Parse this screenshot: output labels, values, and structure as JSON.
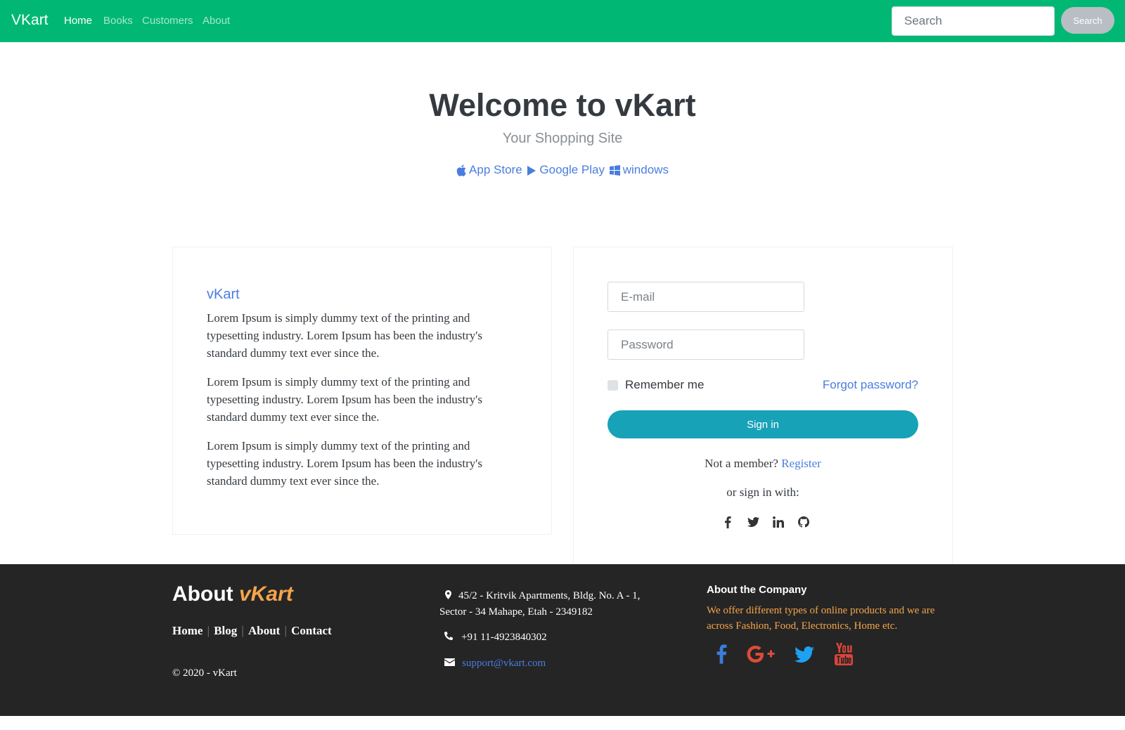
{
  "navbar": {
    "brand": "VKart",
    "links": [
      "Home",
      "Books",
      "Customers",
      "About"
    ],
    "active": "Home",
    "search_placeholder": "Search",
    "search_button": "Search",
    "bg_color": "#00b874"
  },
  "hero": {
    "title": "Welcome to vKart",
    "subtitle": "Your Shopping Site",
    "stores": [
      {
        "label": "App Store",
        "icon": "apple-icon"
      },
      {
        "label": "Google Play",
        "icon": "play-icon"
      },
      {
        "label": "windows",
        "icon": "windows-icon"
      }
    ]
  },
  "info_card": {
    "title": "vKart",
    "paragraphs": [
      "Lorem Ipsum is simply dummy text of the printing and typesetting industry. Lorem Ipsum has been the industry's standard dummy text ever since the.",
      "Lorem Ipsum is simply dummy text of the printing and typesetting industry. Lorem Ipsum has been the industry's standard dummy text ever since the.",
      "Lorem Ipsum is simply dummy text of the printing and typesetting industry. Lorem Ipsum has been the industry's standard dummy text ever since the."
    ]
  },
  "login": {
    "email_placeholder": "E-mail",
    "password_placeholder": "Password",
    "remember_label": "Remember me",
    "forgot_label": "Forgot password?",
    "signin_label": "Sign in",
    "not_member": "Not a member?",
    "register_label": "Register",
    "or_sign_in": "or sign in with:",
    "social": [
      "facebook-icon",
      "twitter-icon",
      "linkedin-icon",
      "github-icon"
    ]
  },
  "footer": {
    "about_prefix": "About",
    "about_brand": "vKart",
    "links": [
      "Home",
      "Blog",
      "About",
      "Contact"
    ],
    "copyright": "© 2020 - vKart",
    "address": "45/2 - Kritvik Apartments, Bldg. No. A - 1, Sector - 34 Mahape, Etah - 2349182",
    "phone": "+91 11-4923840302",
    "email": "support@vkart.com",
    "company_title": "About the Company",
    "company_desc": "We offer different types of online products and we are across Fashion, Food, Electronics, Home etc.",
    "social": [
      "facebook-icon",
      "google-plus-icon",
      "twitter-icon",
      "youtube-icon"
    ],
    "accent_color": "#f5a54a"
  }
}
